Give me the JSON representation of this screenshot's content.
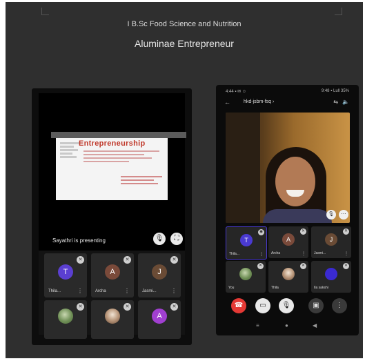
{
  "slide": {
    "title_course": "I B.Sc Food Science and Nutrition",
    "title_main": "Aluminae Entrepreneur"
  },
  "phone1": {
    "presenting_text": "Sayathri is presenting",
    "slide_heading": "Entrepreneurship",
    "participants": [
      {
        "name": "Thila...",
        "initial": "T",
        "color": "#5b3fd1"
      },
      {
        "name": "Archa",
        "initial": "A",
        "color": "#7a4a3a"
      },
      {
        "name": "Jasmi...",
        "initial": "J",
        "color": "#6a4b35"
      },
      {
        "name": "",
        "initial": "",
        "color": "photo"
      },
      {
        "name": "",
        "initial": "",
        "color": "photo2"
      },
      {
        "name": "",
        "initial": "A",
        "color": "#a13fd1"
      }
    ]
  },
  "phone2": {
    "status_left": "4:44 ▪ ✉ ☺",
    "status_right": "9:48 ▪ Lull 35%",
    "meeting_code": "hkd-jsbm-fsq ›",
    "participants": [
      {
        "name": "Thila...",
        "initial": "T",
        "color": "#4a3ad1"
      },
      {
        "name": "Archa",
        "initial": "A",
        "color": "#7a4a3a"
      },
      {
        "name": "Jasmi...",
        "initial": "J",
        "color": "#6a4b35"
      },
      {
        "name": "You",
        "initial": "",
        "color": "photo"
      },
      {
        "name": "Thila",
        "initial": "",
        "color": "photo2"
      },
      {
        "name": "Ila sakshi",
        "initial": "",
        "color": "#3a2ad1"
      }
    ]
  },
  "colors": {
    "slide_bg": "#2f2f2f",
    "end_call": "#e53935",
    "accent": "#4a3ad1"
  }
}
